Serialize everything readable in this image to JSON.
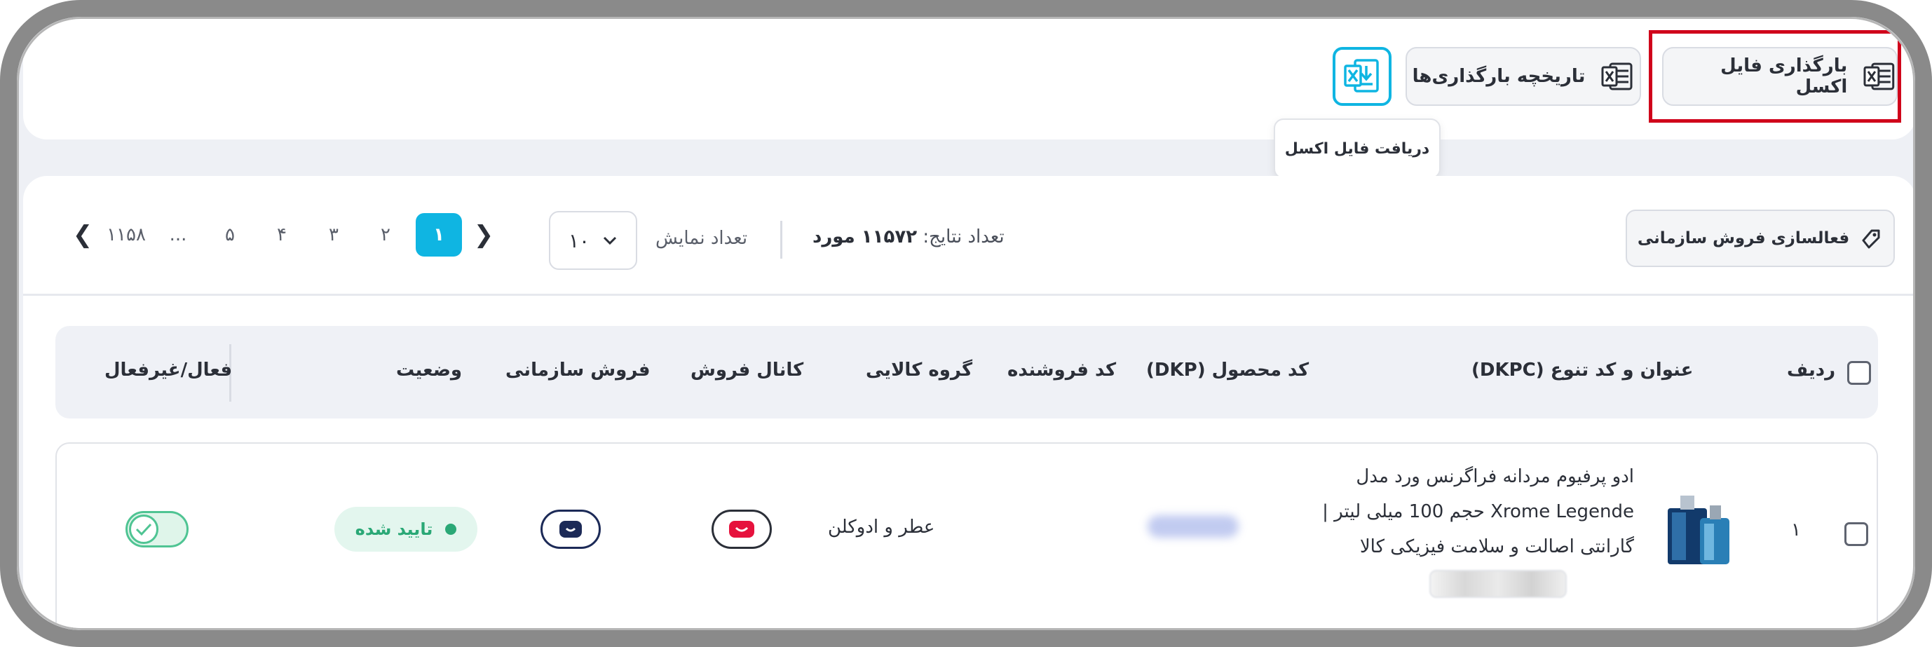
{
  "toolbar": {
    "upload_excel_label": "بارگذاری فایل اکسل",
    "upload_history_label": "تاریخچه بارگذاری‌ها",
    "download_excel_tooltip": "دریافت فایل اکسل"
  },
  "filters": {
    "activate_org_sales_label": "فعالسازی فروش سازمانی",
    "results_label": "تعداد نتایج:",
    "results_value": "۱۱۵۷۲ مورد",
    "show_count_label": "تعداد نمایش",
    "per_page_value": "۱۰"
  },
  "pagination": {
    "pages": [
      "۱۱۵۸",
      "...",
      "۵",
      "۴",
      "۳",
      "۲",
      "۱"
    ],
    "current": "۱"
  },
  "table": {
    "headers": {
      "row": "ردیف",
      "title": "عنوان و کد تنوع (DKPC)",
      "dkp": "کد محصول (DKP)",
      "seller_code": "کد فروشنده",
      "category": "گروه کالایی",
      "channel": "کانال فروش",
      "org_sales": "فروش سازمانی",
      "status": "وضعیت",
      "active": "فعال/غیرفعال"
    },
    "rows": [
      {
        "index": "۱",
        "title_line1": "ادو پرفیوم مردانه فراگرنس ورد مدل",
        "title_line2": "Xrome Legende حجم 100 میلی لیتر |",
        "title_line3": "گارانتی اصالت و سلامت فیزیکی کالا",
        "category": "عطر و ادوکلن",
        "status": "تایید شده"
      }
    ]
  },
  "colors": {
    "accent": "#0fb5e2",
    "highlight_box": "#d0021b",
    "status_green": "#2aa876"
  }
}
